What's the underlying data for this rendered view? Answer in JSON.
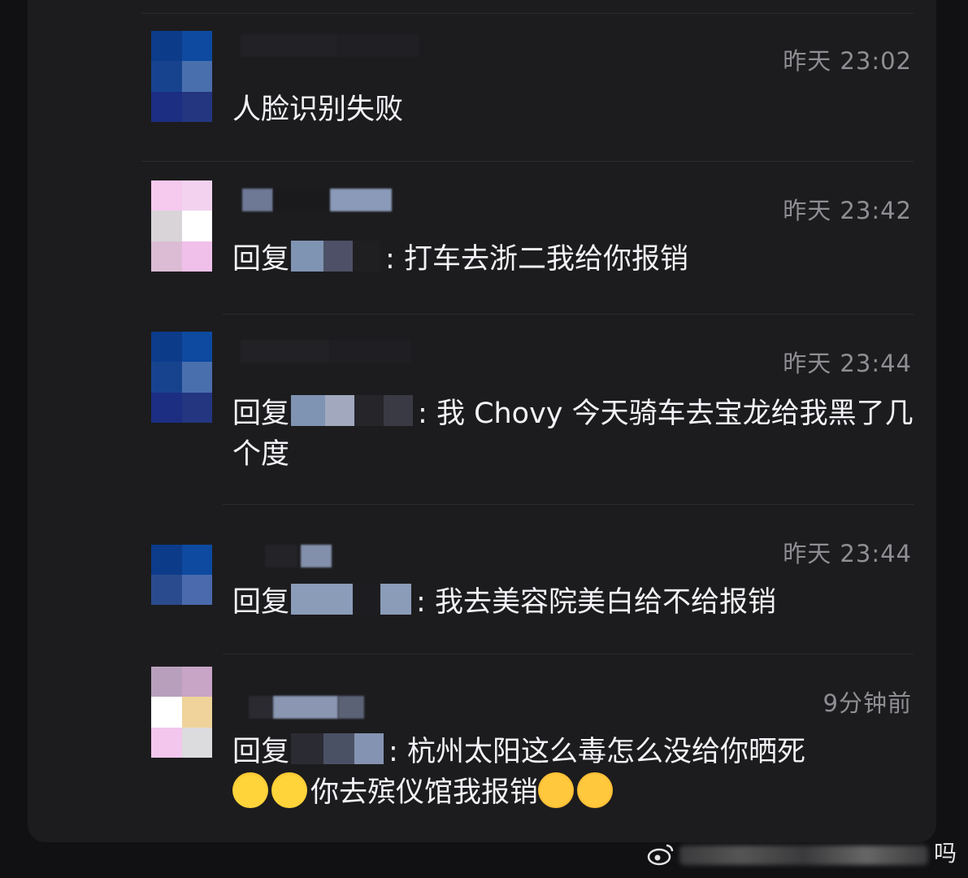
{
  "comments": [
    {
      "time": "昨天 23:02",
      "text": "人脸识别失败",
      "reply_prefix": "",
      "reply_sep": ""
    },
    {
      "time": "昨天 23:42",
      "text": "打车去浙二我给你报销",
      "reply_prefix": "回复",
      "reply_sep": ": "
    },
    {
      "time": "昨天 23:44",
      "text": "我 Chovy 今天骑车去宝龙给我黑了几个度",
      "reply_prefix": "回复",
      "reply_sep": ": "
    },
    {
      "time": "昨天 23:44",
      "text": "我去美容院美白给不给报销",
      "reply_prefix": "回复",
      "reply_sep": ": "
    },
    {
      "time": "9分钟前",
      "text": "杭州太阳这么毒怎么没给你晒死",
      "text_line2": "你去殡仪馆我报销",
      "reply_prefix": "回复",
      "reply_sep": ": "
    }
  ],
  "watermark": {
    "char": "吗"
  },
  "icons": {
    "avatar": "blurred-avatar",
    "emoji_1": "tears-of-joy-emoji",
    "emoji_2": "shy-hand-over-mouth-emoji",
    "watermark": "weibo-icon"
  },
  "colors": {
    "background": "#111113",
    "panel": "#1c1c1e",
    "text": "#f2f2f7",
    "secondary": "#8e8e93"
  }
}
